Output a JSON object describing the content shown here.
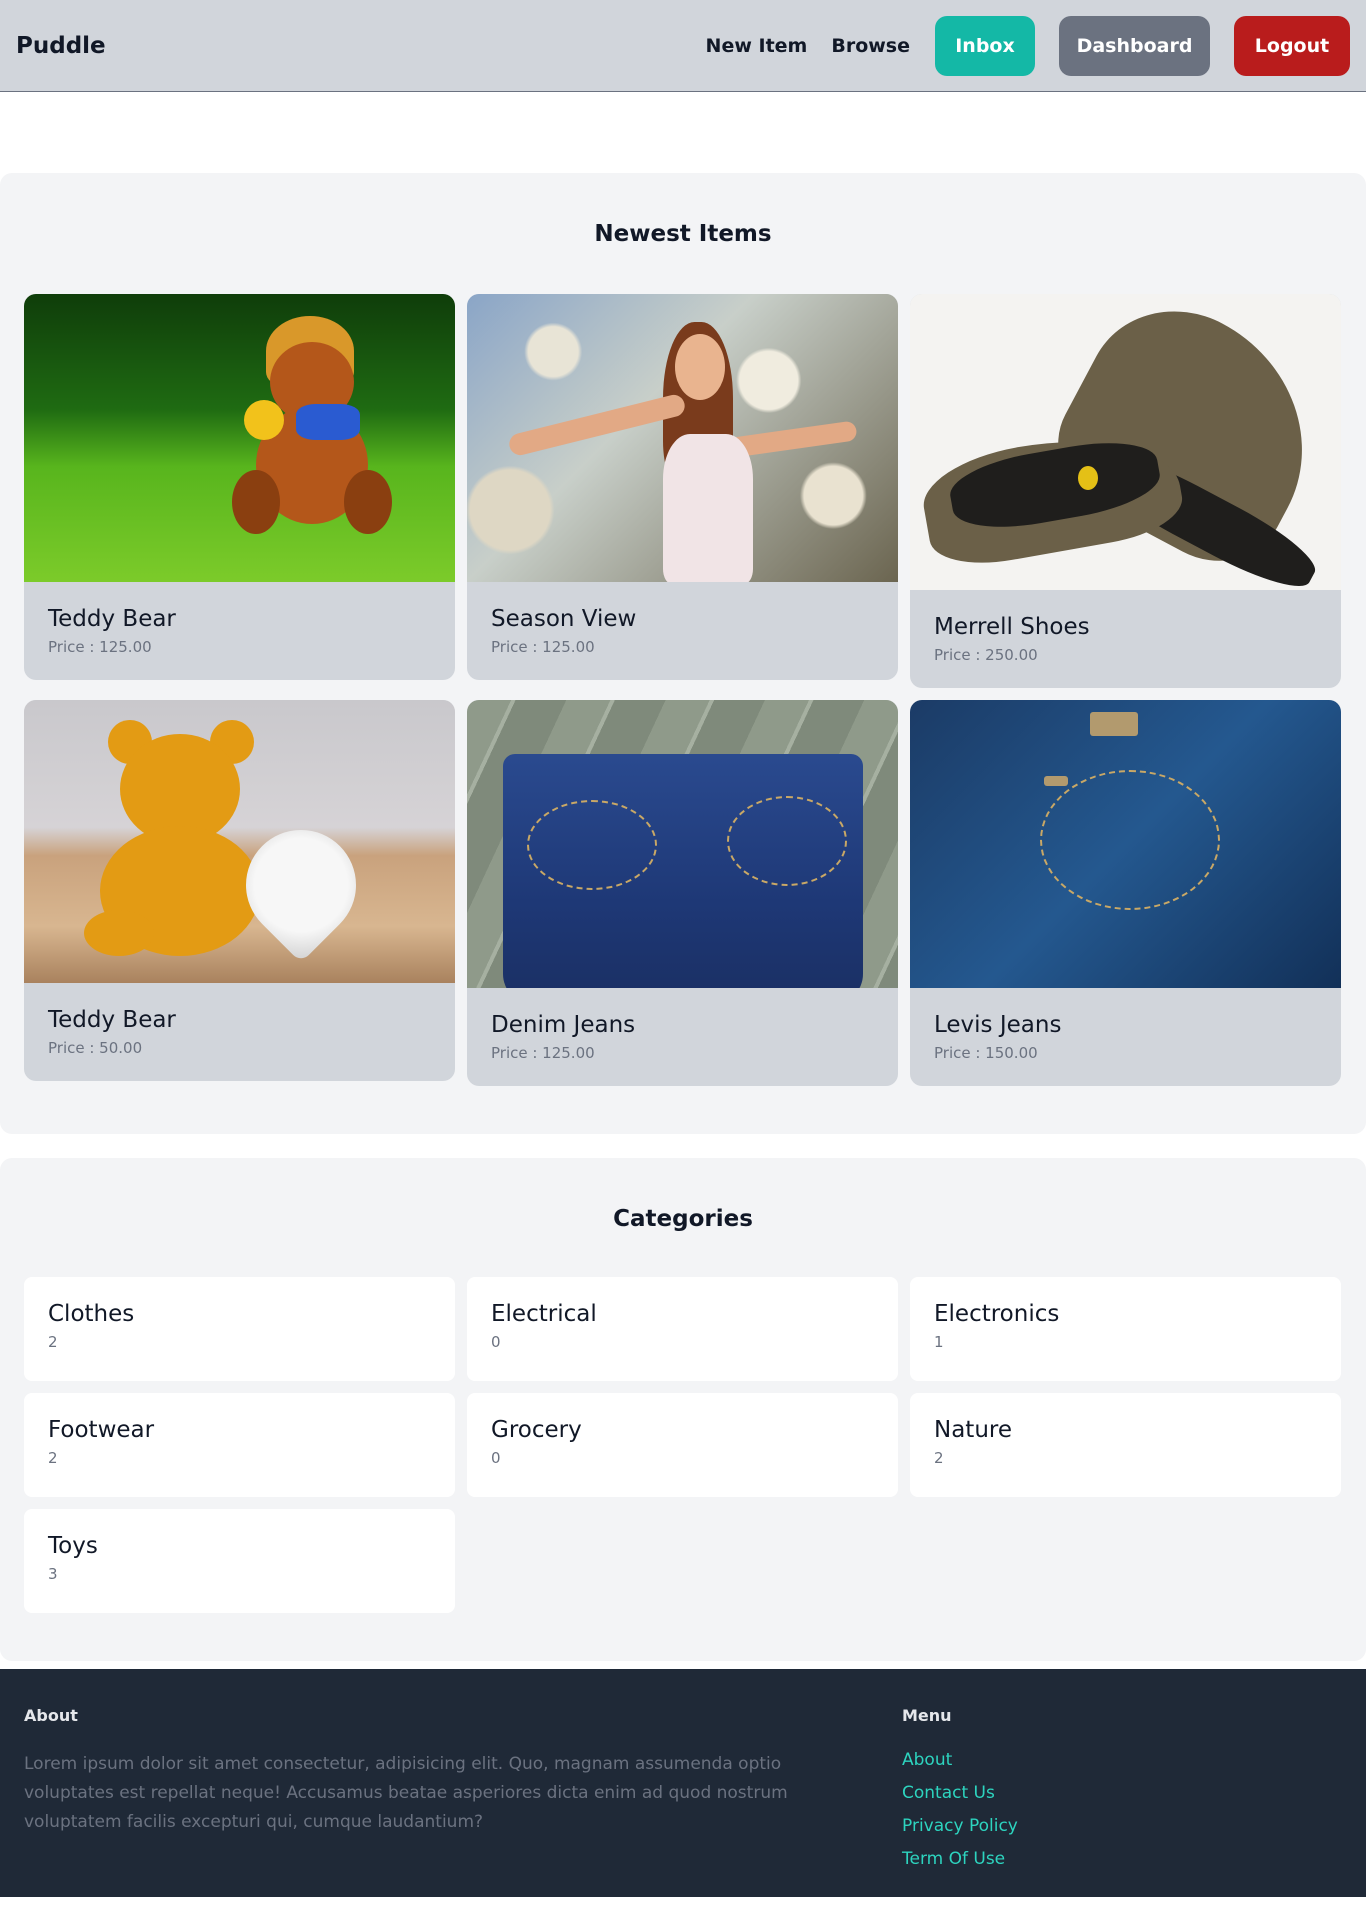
{
  "nav": {
    "brand": "Puddle",
    "links": {
      "new_item": "New Item",
      "browse": "Browse"
    },
    "buttons": {
      "inbox": "Inbox",
      "dashboard": "Dashboard",
      "logout": "Logout"
    },
    "colors": {
      "inbox": "#14b8a6",
      "dashboard": "#6b7280",
      "logout": "#b91c1c"
    }
  },
  "newest": {
    "title": "Newest Items",
    "items": [
      {
        "name": "Teddy Bear",
        "price": "Price : 125.00",
        "image": "teddy-bear-in-grass-photo"
      },
      {
        "name": "Season View",
        "price": "Price : 125.00",
        "image": "woman-in-blossom-tree-photo"
      },
      {
        "name": "Merrell Shoes",
        "price": "Price : 250.00",
        "image": "merrell-shoes-photo"
      },
      {
        "name": "Teddy Bear",
        "price": "Price : 50.00",
        "image": "teddy-bear-with-heart-photo"
      },
      {
        "name": "Denim Jeans",
        "price": "Price : 125.00",
        "image": "denim-jeans-photo"
      },
      {
        "name": "Levis Jeans",
        "price": "Price : 150.00",
        "image": "levis-jeans-photo"
      }
    ]
  },
  "categories": {
    "title": "Categories",
    "items": [
      {
        "name": "Clothes",
        "count": "2"
      },
      {
        "name": "Electrical",
        "count": "0"
      },
      {
        "name": "Electronics",
        "count": "1"
      },
      {
        "name": "Footwear",
        "count": "2"
      },
      {
        "name": "Grocery",
        "count": "0"
      },
      {
        "name": "Nature",
        "count": "2"
      },
      {
        "name": "Toys",
        "count": "3"
      }
    ]
  },
  "footer": {
    "about_title": "About",
    "about_text": "Lorem ipsum dolor sit amet consectetur, adipisicing elit. Quo, magnam assumenda optio voluptates est repellat neque! Accusamus beatae asperiores dicta enim ad quod nostrum voluptatem facilis excepturi qui, cumque laudantium?",
    "menu_title": "Menu",
    "menu": [
      "About",
      "Contact Us",
      "Privacy Policy",
      "Term Of Use"
    ],
    "link_color": "#2dd4bf"
  }
}
